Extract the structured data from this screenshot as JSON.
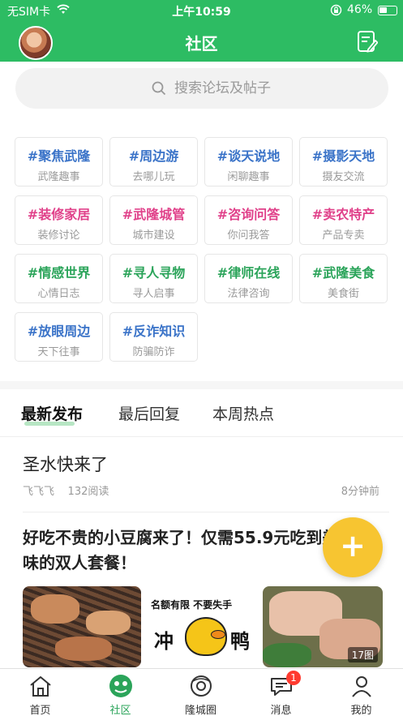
{
  "status_bar": {
    "carrier": "无SIM卡",
    "time": "上午10:59",
    "battery": "46%"
  },
  "nav": {
    "title": "社区"
  },
  "search": {
    "placeholder": "搜索论坛及帖子"
  },
  "categories": [
    {
      "name": "#聚焦武隆",
      "sub": "武隆趣事",
      "color": "#3a73c8"
    },
    {
      "name": "#周边游",
      "sub": "去哪儿玩",
      "color": "#3a73c8"
    },
    {
      "name": "#谈天说地",
      "sub": "闲聊趣事",
      "color": "#3a73c8"
    },
    {
      "name": "#摄影天地",
      "sub": "摄友交流",
      "color": "#3a73c8"
    },
    {
      "name": "#装修家居",
      "sub": "装修讨论",
      "color": "#e0418a"
    },
    {
      "name": "#武隆城管",
      "sub": "城市建设",
      "color": "#e0418a"
    },
    {
      "name": "#咨询问答",
      "sub": "你问我答",
      "color": "#e0418a"
    },
    {
      "name": "#卖农特产",
      "sub": "产品专卖",
      "color": "#e0418a"
    },
    {
      "name": "#情感世界",
      "sub": "心情日志",
      "color": "#2ba45a"
    },
    {
      "name": "#寻人寻物",
      "sub": "寻人启事",
      "color": "#2ba45a"
    },
    {
      "name": "#律师在线",
      "sub": "法律咨询",
      "color": "#2ba45a"
    },
    {
      "name": "#武隆美食",
      "sub": "美食街",
      "color": "#2ba45a"
    },
    {
      "name": "#放眼周边",
      "sub": "天下往事",
      "color": "#3a73c8"
    },
    {
      "name": "#反诈知识",
      "sub": "防骗防诈",
      "color": "#3a73c8"
    }
  ],
  "tabs": [
    "最新发布",
    "最后回复",
    "本周热点"
  ],
  "posts": [
    {
      "title": "圣水快来了",
      "author": "飞飞飞",
      "views": "132阅读",
      "time": "8分钟前"
    },
    {
      "title": "好吃不贵的小豆腐来了！仅需55.9元吃到美味的双人套餐！",
      "image_text_1": "名额有限  不要失手",
      "image_text_chong": "冲",
      "image_text_ya": "鸭",
      "image_count": "17图"
    }
  ],
  "fab": {
    "label": "+"
  },
  "tabbar": [
    {
      "label": "首页",
      "icon": "home-icon"
    },
    {
      "label": "社区",
      "icon": "community-icon"
    },
    {
      "label": "隆城圈",
      "icon": "circle-icon"
    },
    {
      "label": "消息",
      "icon": "message-icon",
      "badge": "1"
    },
    {
      "label": "我的",
      "icon": "profile-icon"
    }
  ],
  "colors": {
    "brand_green": "#2dbc63",
    "fab_yellow": "#f7c531",
    "badge_red": "#ff3b30"
  }
}
